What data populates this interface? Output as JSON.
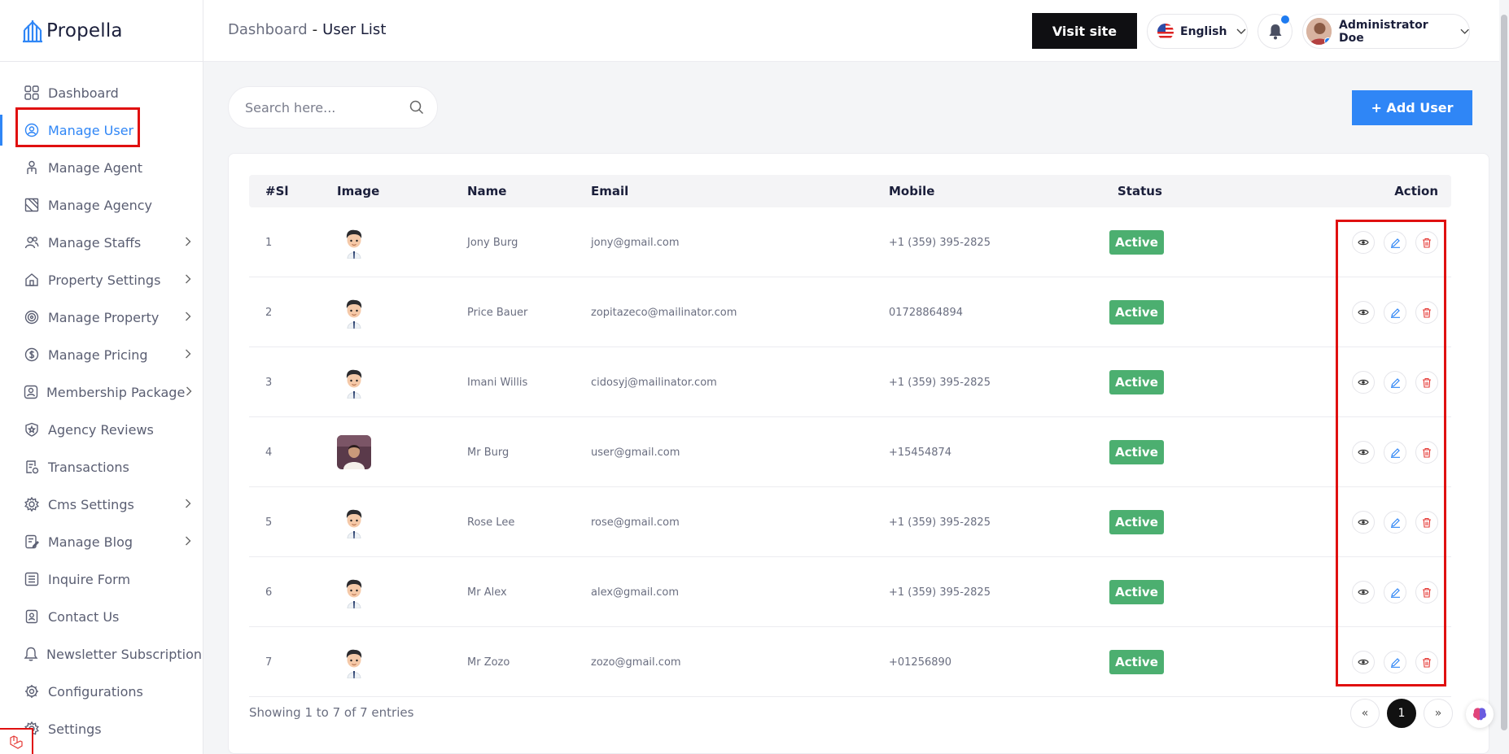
{
  "brand": {
    "name": "Propella"
  },
  "sidebar": {
    "items": [
      {
        "label": "Dashboard",
        "icon": "grid-icon",
        "chevron": false,
        "active": false
      },
      {
        "label": "Manage User",
        "icon": "user-gear-icon",
        "chevron": false,
        "active": true
      },
      {
        "label": "Manage Agent",
        "icon": "agent-icon",
        "chevron": false,
        "active": false
      },
      {
        "label": "Manage Agency",
        "icon": "agency-icon",
        "chevron": false,
        "active": false
      },
      {
        "label": "Manage Staffs",
        "icon": "users-icon",
        "chevron": true,
        "active": false
      },
      {
        "label": "Property Settings",
        "icon": "house-icon",
        "chevron": true,
        "active": false
      },
      {
        "label": "Manage Property",
        "icon": "settings-badge-icon",
        "chevron": true,
        "active": false
      },
      {
        "label": "Manage Pricing",
        "icon": "dollar-icon",
        "chevron": true,
        "active": false
      },
      {
        "label": "Membership Package",
        "icon": "member-icon",
        "chevron": true,
        "active": false
      },
      {
        "label": "Agency Reviews",
        "icon": "star-icon",
        "chevron": false,
        "active": false
      },
      {
        "label": "Transactions",
        "icon": "transaction-icon",
        "chevron": false,
        "active": false
      },
      {
        "label": "Cms Settings",
        "icon": "cog-icon",
        "chevron": true,
        "active": false
      },
      {
        "label": "Manage Blog",
        "icon": "blog-icon",
        "chevron": true,
        "active": false
      },
      {
        "label": "Inquire Form",
        "icon": "form-icon",
        "chevron": false,
        "active": false
      },
      {
        "label": "Contact Us",
        "icon": "contact-icon",
        "chevron": false,
        "active": false
      },
      {
        "label": "Newsletter Subscription",
        "icon": "bell-icon",
        "chevron": false,
        "active": false
      },
      {
        "label": "Configurations",
        "icon": "config-icon",
        "chevron": false,
        "active": false
      },
      {
        "label": "Settings",
        "icon": "gear-icon",
        "chevron": false,
        "active": false
      }
    ]
  },
  "header": {
    "breadcrumb_parent": "Dashboard",
    "breadcrumb_sep": "-",
    "breadcrumb_current": "User List",
    "visit_site": "Visit site",
    "language": "English",
    "admin_name": "Administrator Doe"
  },
  "search": {
    "placeholder": "Search here..."
  },
  "add_user_label": "+ Add User",
  "table": {
    "headers": {
      "sl": "#Sl",
      "image": "Image",
      "name": "Name",
      "email": "Email",
      "mobile": "Mobile",
      "status": "Status",
      "action": "Action"
    },
    "rows": [
      {
        "sl": "1",
        "name": "Jony Burg",
        "email": "jony@gmail.com",
        "mobile": "+1 (359) 395-2825",
        "status": "Active",
        "photo": "cartoon"
      },
      {
        "sl": "2",
        "name": "Price Bauer",
        "email": "zopitazeco@mailinator.com",
        "mobile": "01728864894",
        "status": "Active",
        "photo": "cartoon"
      },
      {
        "sl": "3",
        "name": "Imani Willis",
        "email": "cidosyj@mailinator.com",
        "mobile": "+1 (359) 395-2825",
        "status": "Active",
        "photo": "cartoon"
      },
      {
        "sl": "4",
        "name": "Mr Burg",
        "email": "user@gmail.com",
        "mobile": "+15454874",
        "status": "Active",
        "photo": "photo"
      },
      {
        "sl": "5",
        "name": "Rose Lee",
        "email": "rose@gmail.com",
        "mobile": "+1 (359) 395-2825",
        "status": "Active",
        "photo": "cartoon"
      },
      {
        "sl": "6",
        "name": "Mr Alex",
        "email": "alex@gmail.com",
        "mobile": "+1 (359) 395-2825",
        "status": "Active",
        "photo": "cartoon"
      },
      {
        "sl": "7",
        "name": "Mr Zozo",
        "email": "zozo@gmail.com",
        "mobile": "+01256890",
        "status": "Active",
        "photo": "cartoon"
      }
    ]
  },
  "footer": {
    "showing": "Showing 1 to 7 of 7 entries"
  },
  "pagination": {
    "prev": "«",
    "current": "1",
    "next": "»"
  },
  "colors": {
    "accent": "#2f86f6",
    "active_badge": "#4caf70",
    "highlight": "#e01010",
    "delete": "#e53935"
  }
}
